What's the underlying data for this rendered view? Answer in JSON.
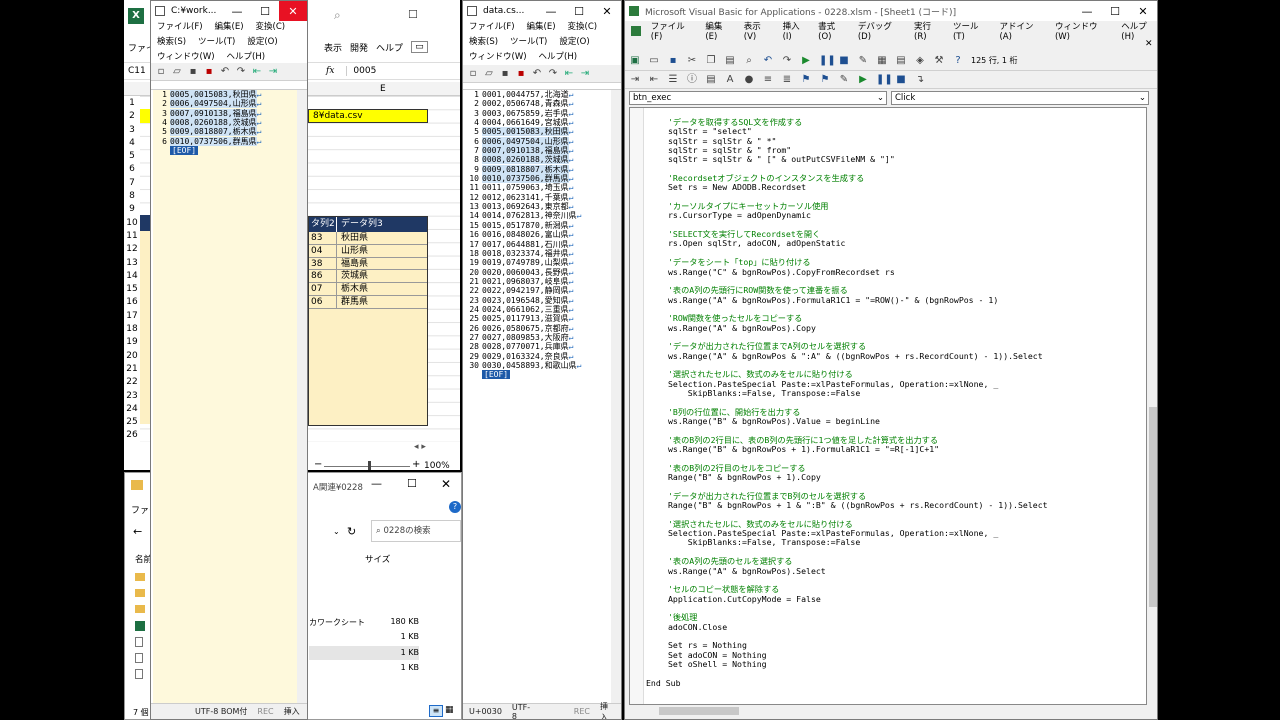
{
  "excel": {
    "ribbon_tabs": [
      "ファイル",
      "表示",
      "開発",
      "ヘルプ"
    ],
    "name_box": "C11",
    "formula_value": "0005",
    "column_e": "E",
    "path_cell": "8¥data.csv",
    "table_headers": [
      "タ列2",
      "データ列3"
    ],
    "table_rows": [
      [
        "83",
        "秋田県"
      ],
      [
        "04",
        "山形県"
      ],
      [
        "38",
        "福島県"
      ],
      [
        "86",
        "茨城県"
      ],
      [
        "07",
        "栃木県"
      ],
      [
        "06",
        "群馬県"
      ]
    ],
    "row_numbers": [
      "1",
      "2",
      "3",
      "4",
      "5",
      "6",
      "7",
      "8",
      "9",
      "10",
      "11",
      "12",
      "13",
      "14",
      "15",
      "16",
      "17",
      "18",
      "19",
      "20",
      "21",
      "22",
      "23",
      "24",
      "25",
      "26"
    ],
    "zoom": "100%"
  },
  "explorer": {
    "title": "A関連¥0228",
    "search_placeholder": "0228の検索",
    "col_name": "名前",
    "col_size": "サイズ",
    "file_type": "カワークシート",
    "sizes": [
      "180 KB",
      "1 KB",
      "1 KB",
      "1 KB"
    ],
    "status_left": "7 個",
    "tab": "ファイ"
  },
  "notepad1": {
    "title": "C:¥work...",
    "menu": [
      "ファイル(F)",
      "編集(E)",
      "変換(C)",
      "検索(S)",
      "ツール(T)",
      "設定(O)",
      "ウィンドウ(W)",
      "ヘルプ(H)"
    ],
    "lines": [
      "0005,0015083,秋田県",
      "0006,0497504,山形県",
      "0007,0910138,福島県",
      "0008,0260188,茨城県",
      "0009,0818807,栃木県",
      "0010,0737506,群馬県"
    ],
    "eof": "[EOF]",
    "status": [
      "UTF-8 BOM付",
      "REC",
      "挿入"
    ]
  },
  "notepad2": {
    "title": "data.cs...",
    "menu": [
      "ファイル(F)",
      "編集(E)",
      "変換(C)",
      "検索(S)",
      "ツール(T)",
      "設定(O)",
      "ウィンドウ(W)",
      "ヘルプ(H)"
    ],
    "lines": [
      "0001,0044757,北海道",
      "0002,0506748,青森県",
      "0003,0675859,岩手県",
      "0004,0661649,宮城県",
      "0005,0015083,秋田県",
      "0006,0497504,山形県",
      "0007,0910138,福島県",
      "0008,0260188,茨城県",
      "0009,0818807,栃木県",
      "0010,0737506,群馬県",
      "0011,0759063,埼玉県",
      "0012,0623141,千葉県",
      "0013,0692643,東京都",
      "0014,0762813,神奈川県",
      "0015,0517870,新潟県",
      "0016,0848026,富山県",
      "0017,0644881,石川県",
      "0018,0323374,福井県",
      "0019,0749789,山梨県",
      "0020,0060043,長野県",
      "0021,0968037,岐阜県",
      "0022,0942197,静岡県",
      "0023,0196548,愛知県",
      "0024,0661062,三重県",
      "0025,0117913,滋賀県",
      "0026,0580675,京都府",
      "0027,0809853,大阪府",
      "0028,0770071,兵庫県",
      "0029,0163324,奈良県",
      "0030,0458893,和歌山県"
    ],
    "eof": "[EOF]",
    "status": [
      "U+0030",
      "UTF-8",
      "REC",
      "挿入"
    ]
  },
  "vba": {
    "title": "Microsoft Visual Basic for Applications - 0228.xlsm - [Sheet1 (コード)]",
    "menu": [
      "ファイル(F)",
      "編集(E)",
      "表示(V)",
      "挿入(I)",
      "書式(O)",
      "デバッグ(D)",
      "実行(R)",
      "ツール(T)",
      "アドイン(A)",
      "ウィンドウ(W)",
      "ヘルプ(H)"
    ],
    "position": "125 行, 1 桁",
    "object_combo": "btn_exec",
    "proc_combo": "Click",
    "code": [
      {
        "t": "c",
        "s": "'データを取得するSQL文を作成する"
      },
      {
        "t": "n",
        "s": "sqlStr = \"select\""
      },
      {
        "t": "n",
        "s": "sqlStr = sqlStr & \" *\""
      },
      {
        "t": "n",
        "s": "sqlStr = sqlStr & \" from\""
      },
      {
        "t": "n",
        "s": "sqlStr = sqlStr & \" [\" & outPutCSVFileNM & \"]\""
      },
      {
        "t": "b",
        "s": ""
      },
      {
        "t": "c",
        "s": "'Recordsetオブジェクトのインスタンスを生成する"
      },
      {
        "t": "n",
        "s": "Set rs = New ADODB.Recordset"
      },
      {
        "t": "b",
        "s": ""
      },
      {
        "t": "c",
        "s": "'カーソルタイプにキーセットカーソル使用"
      },
      {
        "t": "n",
        "s": "rs.CursorType = adOpenDynamic"
      },
      {
        "t": "b",
        "s": ""
      },
      {
        "t": "c",
        "s": "'SELECT文を実行してRecordsetを開く"
      },
      {
        "t": "n",
        "s": "rs.Open sqlStr, adoCON, adOpenStatic"
      },
      {
        "t": "b",
        "s": ""
      },
      {
        "t": "c",
        "s": "'データをシート「top」に貼り付ける"
      },
      {
        "t": "n",
        "s": "ws.Range(\"C\" & bgnRowPos).CopyFromRecordset rs"
      },
      {
        "t": "b",
        "s": ""
      },
      {
        "t": "c",
        "s": "'表のA列の先頭行にROW関数を使って連番を振る"
      },
      {
        "t": "n",
        "s": "ws.Range(\"A\" & bgnRowPos).FormulaR1C1 = \"=ROW()-\" & (bgnRowPos - 1)"
      },
      {
        "t": "b",
        "s": ""
      },
      {
        "t": "c",
        "s": "'ROW関数を使ったセルをコピーする"
      },
      {
        "t": "n",
        "s": "ws.Range(\"A\" & bgnRowPos).Copy"
      },
      {
        "t": "b",
        "s": ""
      },
      {
        "t": "c",
        "s": "'データが出力された行位置までA列のセルを選択する"
      },
      {
        "t": "n",
        "s": "ws.Range(\"A\" & bgnRowPos & \":A\" & ((bgnRowPos + rs.RecordCount) - 1)).Select"
      },
      {
        "t": "b",
        "s": ""
      },
      {
        "t": "c",
        "s": "'選択されたセルに、数式のみをセルに貼り付ける"
      },
      {
        "t": "n",
        "s": "Selection.PasteSpecial Paste:=xlPasteFormulas, Operation:=xlNone, _"
      },
      {
        "t": "n",
        "s": "    SkipBlanks:=False, Transpose:=False"
      },
      {
        "t": "b",
        "s": ""
      },
      {
        "t": "c",
        "s": "'B列の行位置に、開始行を出力する"
      },
      {
        "t": "n",
        "s": "ws.Range(\"B\" & bgnRowPos).Value = beginLine"
      },
      {
        "t": "b",
        "s": ""
      },
      {
        "t": "c",
        "s": "'表のB列の2行目に、表のB列の先頭行に1つ値を足した計算式を出力する"
      },
      {
        "t": "n",
        "s": "ws.Range(\"B\" & bgnRowPos + 1).FormulaR1C1 = \"=R[-1]C+1\""
      },
      {
        "t": "b",
        "s": ""
      },
      {
        "t": "c",
        "s": "'表のB列の2行目のセルをコピーする"
      },
      {
        "t": "n",
        "s": "Range(\"B\" & bgnRowPos + 1).Copy"
      },
      {
        "t": "b",
        "s": ""
      },
      {
        "t": "c",
        "s": "'データが出力された行位置までB列のセルを選択する"
      },
      {
        "t": "n",
        "s": "Range(\"B\" & bgnRowPos + 1 & \":B\" & ((bgnRowPos + rs.RecordCount) - 1)).Select"
      },
      {
        "t": "b",
        "s": ""
      },
      {
        "t": "c",
        "s": "'選択されたセルに、数式のみをセルに貼り付ける"
      },
      {
        "t": "n",
        "s": "Selection.PasteSpecial Paste:=xlPasteFormulas, Operation:=xlNone, _"
      },
      {
        "t": "n",
        "s": "    SkipBlanks:=False, Transpose:=False"
      },
      {
        "t": "b",
        "s": ""
      },
      {
        "t": "c",
        "s": "'表のA列の先頭のセルを選択する"
      },
      {
        "t": "n",
        "s": "ws.Range(\"A\" & bgnRowPos).Select"
      },
      {
        "t": "b",
        "s": ""
      },
      {
        "t": "c",
        "s": "'セルのコピー状態を解除する"
      },
      {
        "t": "n",
        "s": "Application.CutCopyMode = False"
      },
      {
        "t": "b",
        "s": ""
      },
      {
        "t": "c",
        "s": "'後処理"
      },
      {
        "t": "n",
        "s": "adoCON.Close"
      },
      {
        "t": "b",
        "s": ""
      },
      {
        "t": "n",
        "s": "Set rs = Nothing"
      },
      {
        "t": "n",
        "s": "Set adoCON = Nothing"
      },
      {
        "t": "n",
        "s": "Set oShell = Nothing"
      },
      {
        "t": "b",
        "s": ""
      },
      {
        "t": "e",
        "s": "End Sub"
      }
    ]
  }
}
